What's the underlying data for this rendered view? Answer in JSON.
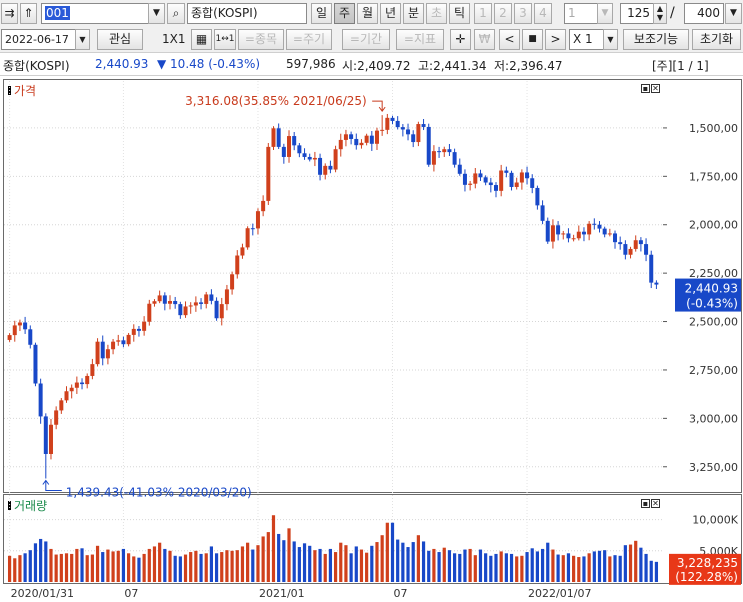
{
  "toolbar1": {
    "code": "001",
    "name": "종합(KOSPI)",
    "periods": [
      "일",
      "주",
      "월",
      "년",
      "분",
      "초",
      "틱"
    ],
    "selected_period": "주",
    "minutes": [
      "1",
      "2",
      "3",
      "4"
    ],
    "unit_value": "1",
    "count": "125",
    "total": "400",
    "slash": "/"
  },
  "toolbar2": {
    "date": "2022-06-17",
    "interest_label": "관심",
    "layout_label": "1X1",
    "grid_label": "1↔1",
    "buttons": [
      "=종목",
      "=주기",
      "=기간",
      "=지표"
    ],
    "crosshair": "✛",
    "won": "₩",
    "nav": [
      "<",
      "■",
      ">"
    ],
    "multiplier": "X 1",
    "aux_label": "보조기능",
    "reset_label": "초기화"
  },
  "info": {
    "name": "종합(KOSPI)",
    "price": "2,440.93",
    "change": "▼ 10.48 (-0.43%)",
    "volume": "597,986",
    "open": "시:2,409.72",
    "high": "고:2,441.34",
    "low": "저:2,396.47",
    "right": "[주][1 / 1]"
  },
  "price_panel": {
    "title": "가격",
    "high_note": "3,316.08(35.85% 2021/06/25)",
    "low_note": "1,439.43(-41.03% 2020/03/20)",
    "current_price": "2,440.93",
    "current_change": "(-0.43%)",
    "y_ticks": [
      "3,250,00",
      "3,000,00",
      "2,750,00",
      "2,500,00",
      "2,250,00",
      "2,000,00",
      "1,750,00",
      "1,500,00"
    ]
  },
  "volume_panel": {
    "title": "거래량",
    "y_ticks": [
      "10,000K",
      "5,000K"
    ],
    "current_volume": "3,228,235",
    "current_ratio": "(122.28%)"
  },
  "x_ticks": [
    "2020/01/31",
    "07",
    "2021/01",
    "07",
    "2022/01/07"
  ],
  "colors": {
    "up": "#d0401c",
    "down": "#1848c8",
    "label_bg": "#1848c8",
    "vol_label_bg": "#e83818"
  },
  "chart_data": {
    "type": "candlestick",
    "title": "종합(KOSPI)",
    "period": "weekly",
    "x_ticks": [
      "2020/01/31",
      "07",
      "2021/01",
      "07",
      "2022/01/07"
    ],
    "ylim": [
      1380,
      3420
    ],
    "y_ticks": [
      1500,
      1750,
      2000,
      2250,
      2500,
      2750,
      3000,
      3250
    ],
    "volume_ylim": [
      0,
      12500
    ],
    "volume_ticks_k": [
      5000,
      10000
    ],
    "annotations": [
      {
        "label": "3,316.08(35.85% 2021/06/25)",
        "value": 3316.08
      },
      {
        "label": "1,439.43(-41.03% 2020/03/20)",
        "value": 1439.43
      }
    ],
    "close": [
      2180,
      2230,
      2245,
      2210,
      2130,
      1930,
      1760,
      1566,
      1717,
      1791,
      1843,
      1890,
      1908,
      1935,
      1927,
      1969,
      2030,
      2146,
      2060,
      2107,
      2146,
      2153,
      2133,
      2181,
      2212,
      2202,
      2249,
      2342,
      2355,
      2385,
      2342,
      2356,
      2340,
      2283,
      2328,
      2333,
      2349,
      2341,
      2390,
      2357,
      2267,
      2340,
      2416,
      2494,
      2591,
      2633,
      2732,
      2731,
      2820,
      2873,
      3152,
      3248,
      3152,
      3100,
      3208,
      3160,
      3119,
      3100,
      3087,
      3095,
      3008,
      3054,
      3035,
      3140,
      3188,
      3217,
      3193,
      3161,
      3173,
      3210,
      3168,
      3236,
      3240,
      3302,
      3286,
      3254,
      3242,
      3217,
      3177,
      3270,
      3255,
      3060,
      3130,
      3125,
      3140,
      3125,
      3060,
      3013,
      2956,
      2962,
      3015,
      2995,
      2968,
      2955,
      2925,
      3030,
      3018,
      2945,
      2968,
      3020,
      2990,
      2940,
      2850,
      2770,
      2663,
      2747,
      2700,
      2705,
      2680,
      2680,
      2714,
      2700,
      2755,
      2750,
      2730,
      2700,
      2705,
      2660,
      2650,
      2595,
      2625,
      2670,
      2650,
      2595,
      2451,
      2441
    ],
    "volume_k": [
      4200,
      3800,
      4300,
      4600,
      5100,
      6200,
      6900,
      6500,
      5300,
      4400,
      4500,
      4600,
      4500,
      5300,
      5400,
      4300,
      4400,
      5800,
      4800,
      5200,
      4900,
      5000,
      5300,
      4600,
      4100,
      3900,
      4500,
      5300,
      5700,
      6300,
      5300,
      5000,
      4200,
      4100,
      4400,
      4800,
      5000,
      4500,
      4600,
      5700,
      4600,
      4800,
      5100,
      5000,
      5100,
      5700,
      6300,
      5200,
      5900,
      7300,
      8000,
      10700,
      7700,
      6700,
      8600,
      6500,
      5600,
      6200,
      5800,
      5100,
      5300,
      4500,
      5300,
      4800,
      6300,
      5900,
      4600,
      5700,
      5200,
      4700,
      5800,
      6400,
      7500,
      9500,
      9500,
      6800,
      6300,
      5600,
      6400,
      7500,
      6500,
      5000,
      5300,
      4800,
      5500,
      5100,
      4600,
      4500,
      5200,
      5300,
      4300,
      5200,
      4600,
      4200,
      4500,
      4900,
      4600,
      4500,
      4100,
      4200,
      4800,
      5400,
      4900,
      5300,
      6300,
      5200,
      4400,
      4300,
      4600,
      4200,
      4000,
      4100,
      4600,
      4900,
      5000,
      5100,
      4100,
      4300,
      4200,
      5900,
      6000,
      6600,
      5500,
      4500,
      3400,
      3228
    ]
  }
}
